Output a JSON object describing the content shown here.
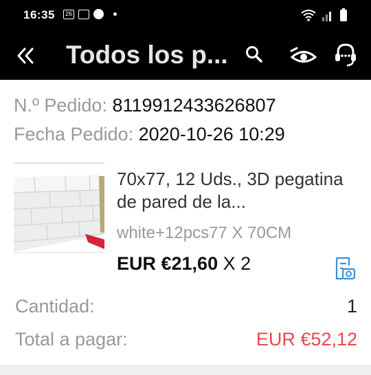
{
  "status_bar": {
    "time": "16:35",
    "notif_label": "26"
  },
  "app_bar": {
    "title": "Todos los p..."
  },
  "order": {
    "number_label": "N.º Pedido:",
    "number_value": "8119912433626807",
    "date_label": "Fecha Pedido:",
    "date_value": "2020-10-26 10:29"
  },
  "product": {
    "name": "70x77, 12 Uds., 3D pegatina de pared de la...",
    "variant": "white+12pcs77 X 70CM",
    "price": "EUR €21,60",
    "quantity_suffix": " X 2"
  },
  "summary": {
    "quantity_label": "Cantidad:",
    "quantity_value": "1",
    "total_label": "Total a pagar:",
    "total_value": "EUR €52,12"
  },
  "colors": {
    "header_bg": "#000000",
    "total_red": "#e8474d",
    "icon_blue": "#3b8fd6"
  },
  "icons": [
    "back-arrows-icon",
    "search-icon",
    "eye-icon",
    "customer-service-icon",
    "snapshot-icon"
  ]
}
